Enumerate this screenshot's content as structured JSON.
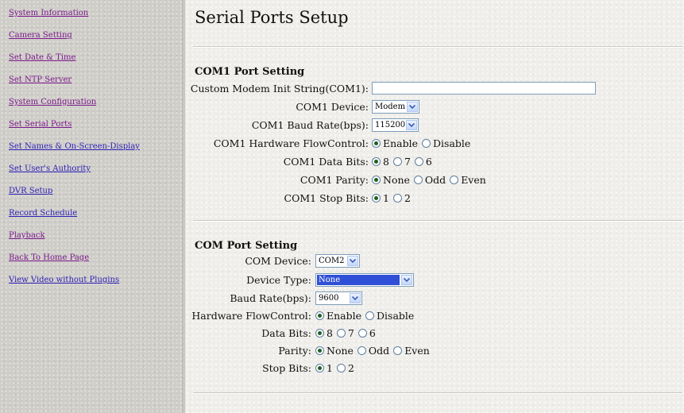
{
  "sidebar": {
    "items": [
      {
        "label": "System Information",
        "visited": true
      },
      {
        "label": "Camera Setting",
        "visited": true
      },
      {
        "label": "Set Date & Time",
        "visited": true
      },
      {
        "label": "Set NTP Server",
        "visited": true
      },
      {
        "label": "System Configuration",
        "visited": true
      },
      {
        "label": "Set Serial Ports",
        "visited": true
      },
      {
        "label": "Set Names & On-Screen-Display",
        "visited": false
      },
      {
        "label": "Set User's Authority",
        "visited": false
      },
      {
        "label": "DVR Setup",
        "visited": false
      },
      {
        "label": "Record Schedule",
        "visited": false
      },
      {
        "label": "Playback",
        "visited": true
      },
      {
        "label": "Back To Home Page",
        "visited": true
      },
      {
        "label": "View Video without Plugins",
        "visited": false
      }
    ]
  },
  "page_title": "Serial Ports Setup",
  "com1": {
    "title": "COM1 Port Setting",
    "init_string": {
      "label": "Custom Modem Init String(COM1):",
      "value": ""
    },
    "device": {
      "label": "COM1 Device:",
      "value": "Modem"
    },
    "baud": {
      "label": "COM1 Baud Rate(bps):",
      "value": "115200"
    },
    "flow": {
      "label": "COM1 Hardware FlowControl:",
      "options": [
        "Enable",
        "Disable"
      ],
      "selected": "Enable"
    },
    "data_bits": {
      "label": "COM1 Data Bits:",
      "options": [
        "8",
        "7",
        "6"
      ],
      "selected": "8"
    },
    "parity": {
      "label": "COM1 Parity:",
      "options": [
        "None",
        "Odd",
        "Even"
      ],
      "selected": "None"
    },
    "stop_bits": {
      "label": "COM1 Stop Bits:",
      "options": [
        "1",
        "2"
      ],
      "selected": "1"
    }
  },
  "com": {
    "title": "COM Port Setting",
    "device": {
      "label": "COM Device:",
      "value": "COM2"
    },
    "device_type": {
      "label": "Device Type:",
      "value": "None"
    },
    "baud": {
      "label": "Baud Rate(bps):",
      "value": "9600"
    },
    "flow": {
      "label": "Hardware FlowControl:",
      "options": [
        "Enable",
        "Disable"
      ],
      "selected": "Enable"
    },
    "data_bits": {
      "label": "Data Bits:",
      "options": [
        "8",
        "7",
        "6"
      ],
      "selected": "8"
    },
    "parity": {
      "label": "Parity:",
      "options": [
        "None",
        "Odd",
        "Even"
      ],
      "selected": "None"
    },
    "stop_bits": {
      "label": "Stop Bits:",
      "options": [
        "1",
        "2"
      ],
      "selected": "1"
    }
  },
  "colors": {
    "link": "#2a1fb5",
    "visited_link": "#7a1a8a",
    "select_highlight": "#2f4fd6"
  }
}
